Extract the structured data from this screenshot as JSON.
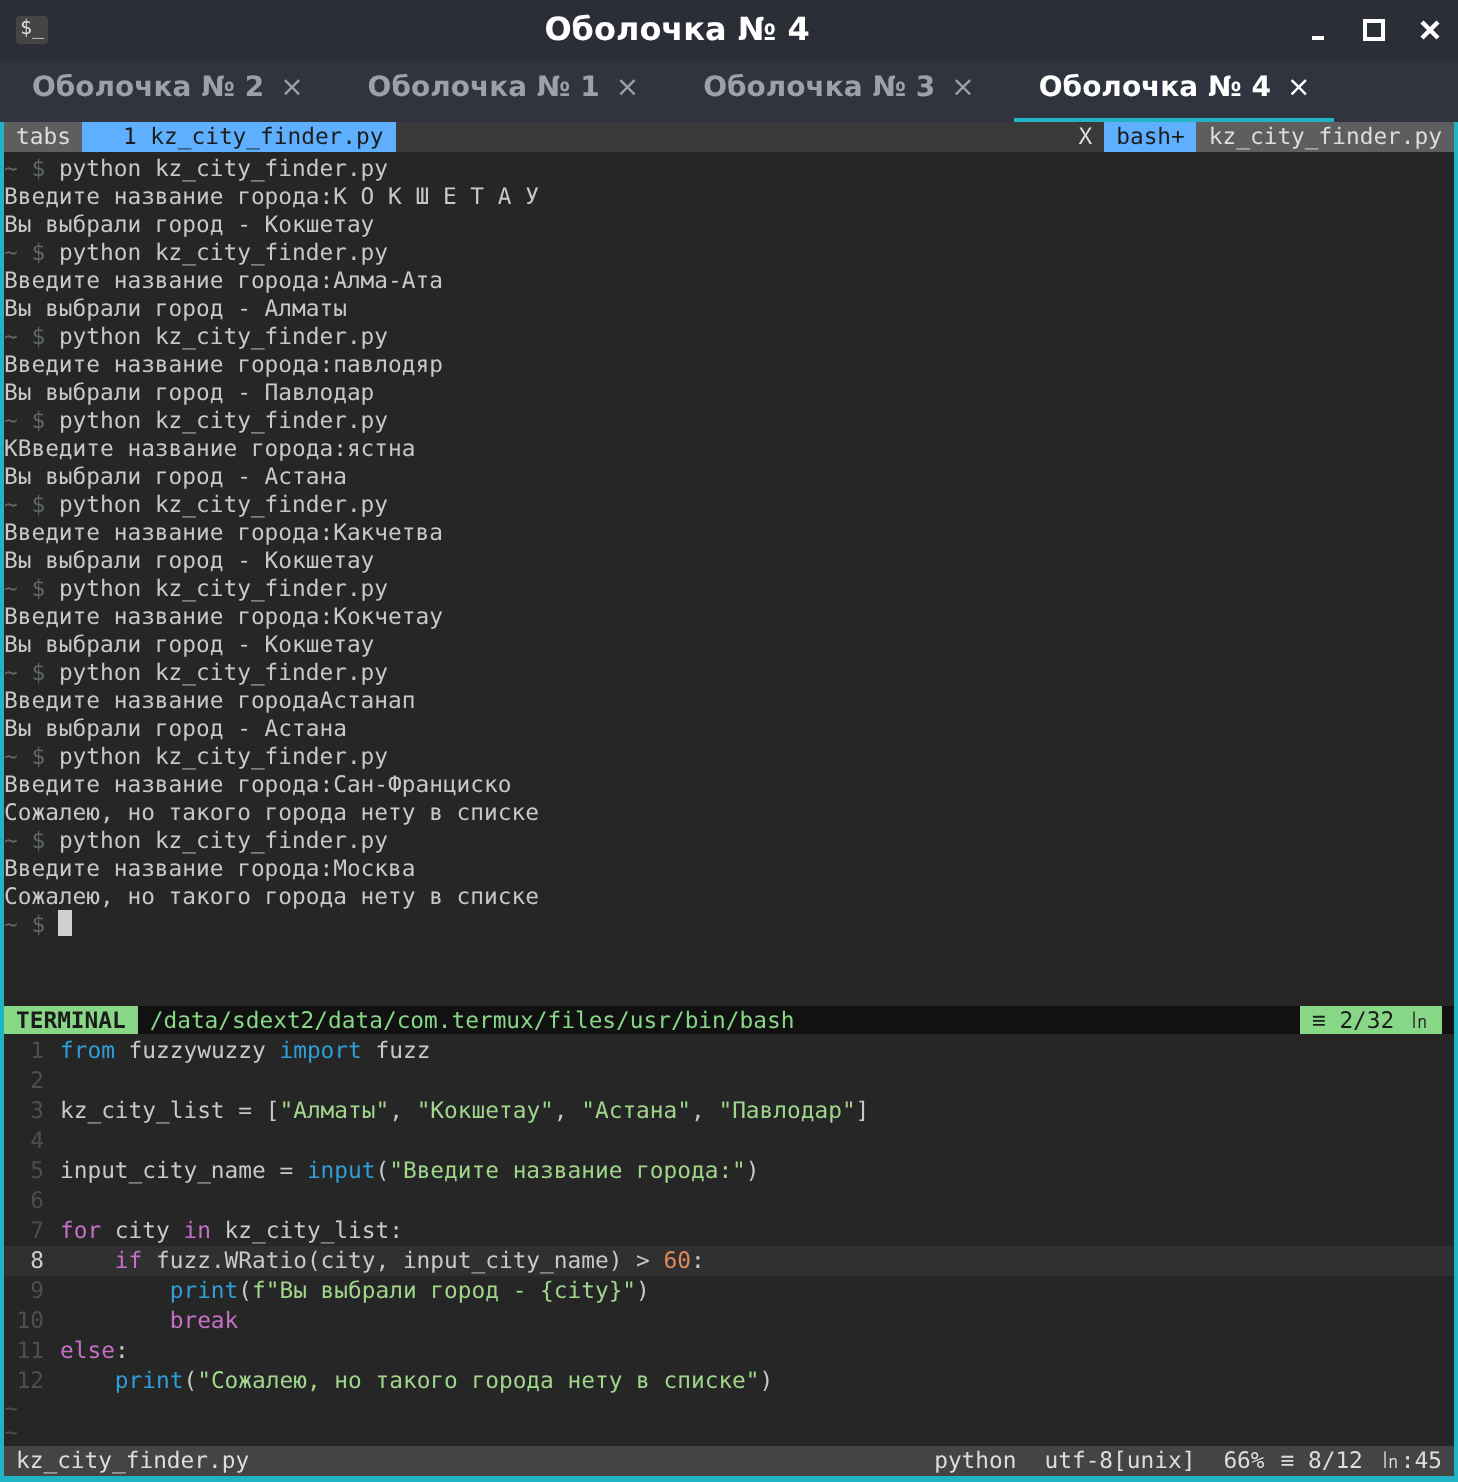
{
  "window": {
    "title": "Оболочка № 4",
    "icon": "$_"
  },
  "tabs": [
    {
      "label": "Оболочка № 2",
      "close": "×",
      "selected": false
    },
    {
      "label": "Оболочка № 1",
      "close": "×",
      "selected": false
    },
    {
      "label": "Оболочка № 3",
      "close": "×",
      "selected": false
    },
    {
      "label": "Оболочка № 4",
      "close": "×",
      "selected": true
    }
  ],
  "buffer_bar": {
    "label": "tabs",
    "buffers": [
      {
        "label": "1 kz_city_finder.py",
        "selected": true
      }
    ],
    "close": "X",
    "right": [
      {
        "label": "bash+",
        "selected": true
      },
      {
        "label": "kz_city_finder.py",
        "selected": false
      }
    ]
  },
  "terminal": {
    "prompt": "~ $",
    "lines": [
      {
        "kind": "prompt",
        "text": "python kz_city_finder.py"
      },
      {
        "kind": "output",
        "text": "Введите название города:К О К Ш Е Т А У"
      },
      {
        "kind": "output",
        "text": "Вы выбрали город - Кокшетау"
      },
      {
        "kind": "prompt",
        "text": "python kz_city_finder.py"
      },
      {
        "kind": "output",
        "text": "Введите название города:Алма-Ата"
      },
      {
        "kind": "output",
        "text": "Вы выбрали город - Алматы"
      },
      {
        "kind": "prompt",
        "text": "python kz_city_finder.py"
      },
      {
        "kind": "output",
        "text": "Введите название города:павлодяр"
      },
      {
        "kind": "output",
        "text": "Вы выбрали город - Павлодар"
      },
      {
        "kind": "prompt",
        "text": "python kz_city_finder.py"
      },
      {
        "kind": "output",
        "text": "КВведите название города:ястна"
      },
      {
        "kind": "output",
        "text": "Вы выбрали город - Астана"
      },
      {
        "kind": "prompt",
        "text": "python kz_city_finder.py"
      },
      {
        "kind": "output",
        "text": "Введите название города:Какчетва"
      },
      {
        "kind": "output",
        "text": "Вы выбрали город - Кокшетау"
      },
      {
        "kind": "prompt",
        "text": "python kz_city_finder.py"
      },
      {
        "kind": "output",
        "text": "Введите название города:Кокчетау"
      },
      {
        "kind": "output",
        "text": "Вы выбрали город - Кокшетау"
      },
      {
        "kind": "prompt",
        "text": "python kz_city_finder.py"
      },
      {
        "kind": "output",
        "text": "Введите название городаАстанап"
      },
      {
        "kind": "output",
        "text": "Вы выбрали город - Астана"
      },
      {
        "kind": "prompt",
        "text": "python kz_city_finder.py"
      },
      {
        "kind": "output",
        "text": "Введите название города:Сан-Франциско"
      },
      {
        "kind": "output",
        "text": "Сожалею, но такого города нету в списке"
      },
      {
        "kind": "prompt",
        "text": "python kz_city_finder.py"
      },
      {
        "kind": "output",
        "text": "Введите название города:Москва"
      },
      {
        "kind": "output",
        "text": "Сожалею, но такого города нету в списке"
      },
      {
        "kind": "cursor"
      }
    ]
  },
  "terminal_status": {
    "mode": "TERMINAL",
    "path": "/data/sdext2/data/com.termux/files/usr/bin/bash",
    "position": "≡ 2/32 ㏑"
  },
  "editor": {
    "lines": [
      {
        "number": "1",
        "selected": false,
        "tokens": [
          {
            "kind": "keyword",
            "text": "from"
          },
          {
            "kind": "plain",
            "text": " fuzzywuzzy "
          },
          {
            "kind": "keyword",
            "text": "import"
          },
          {
            "kind": "plain",
            "text": " fuzz"
          }
        ]
      },
      {
        "number": "2",
        "selected": false
      },
      {
        "number": "3",
        "selected": false,
        "tokens": [
          {
            "kind": "plain",
            "text": "kz_city_list = ["
          },
          {
            "kind": "string",
            "text": "\"Алматы\""
          },
          {
            "kind": "plain",
            "text": ", "
          },
          {
            "kind": "string",
            "text": "\"Кокшетау\""
          },
          {
            "kind": "plain",
            "text": ", "
          },
          {
            "kind": "string",
            "text": "\"Астана\""
          },
          {
            "kind": "plain",
            "text": ", "
          },
          {
            "kind": "string",
            "text": "\"Павлодар\""
          },
          {
            "kind": "plain",
            "text": "]"
          }
        ]
      },
      {
        "number": "4",
        "selected": false
      },
      {
        "number": "5",
        "selected": false,
        "tokens": [
          {
            "kind": "plain",
            "text": "input_city_name = "
          },
          {
            "kind": "builtin",
            "text": "input"
          },
          {
            "kind": "plain",
            "text": "("
          },
          {
            "kind": "string",
            "text": "\"Введите название города:\""
          },
          {
            "kind": "plain",
            "text": ")"
          }
        ]
      },
      {
        "number": "6",
        "selected": false
      },
      {
        "number": "7",
        "selected": false,
        "tokens": [
          {
            "kind": "control",
            "text": "for"
          },
          {
            "kind": "plain",
            "text": " city "
          },
          {
            "kind": "control",
            "text": "in"
          },
          {
            "kind": "plain",
            "text": " kz_city_list:"
          }
        ]
      },
      {
        "number": "8",
        "selected": true,
        "tokens": [
          {
            "kind": "control",
            "text": "    if"
          },
          {
            "kind": "plain",
            "text": " fuzz.WRatio(city, input_city_name) > "
          },
          {
            "kind": "number",
            "text": "60"
          },
          {
            "kind": "plain",
            "text": ":"
          }
        ]
      },
      {
        "number": "9",
        "selected": false,
        "tokens": [
          {
            "kind": "builtin",
            "text": "        print"
          },
          {
            "kind": "plain",
            "text": "("
          },
          {
            "kind": "string",
            "text": "f\"Вы выбрали город - {city}\""
          },
          {
            "kind": "plain",
            "text": ")"
          }
        ]
      },
      {
        "number": "10",
        "selected": false,
        "tokens": [
          {
            "kind": "control",
            "text": "        break"
          }
        ]
      },
      {
        "number": "11",
        "selected": false,
        "tokens": [
          {
            "kind": "control",
            "text": "else"
          },
          {
            "kind": "plain",
            "text": ":"
          }
        ]
      },
      {
        "number": "12",
        "selected": false,
        "tokens": [
          {
            "kind": "builtin",
            "text": "    print"
          },
          {
            "kind": "plain",
            "text": "("
          },
          {
            "kind": "string",
            "text": "\"Сожалею, но такого города нету в списке\""
          },
          {
            "kind": "plain",
            "text": ")"
          }
        ]
      }
    ],
    "filler": [
      "~",
      "~"
    ]
  },
  "status_line": {
    "file": "kz_city_finder.py",
    "filetype": "python",
    "encoding": "utf-8[unix]",
    "percent": "66%",
    "position": "≡ 8/12",
    "column": "㏑:45"
  }
}
